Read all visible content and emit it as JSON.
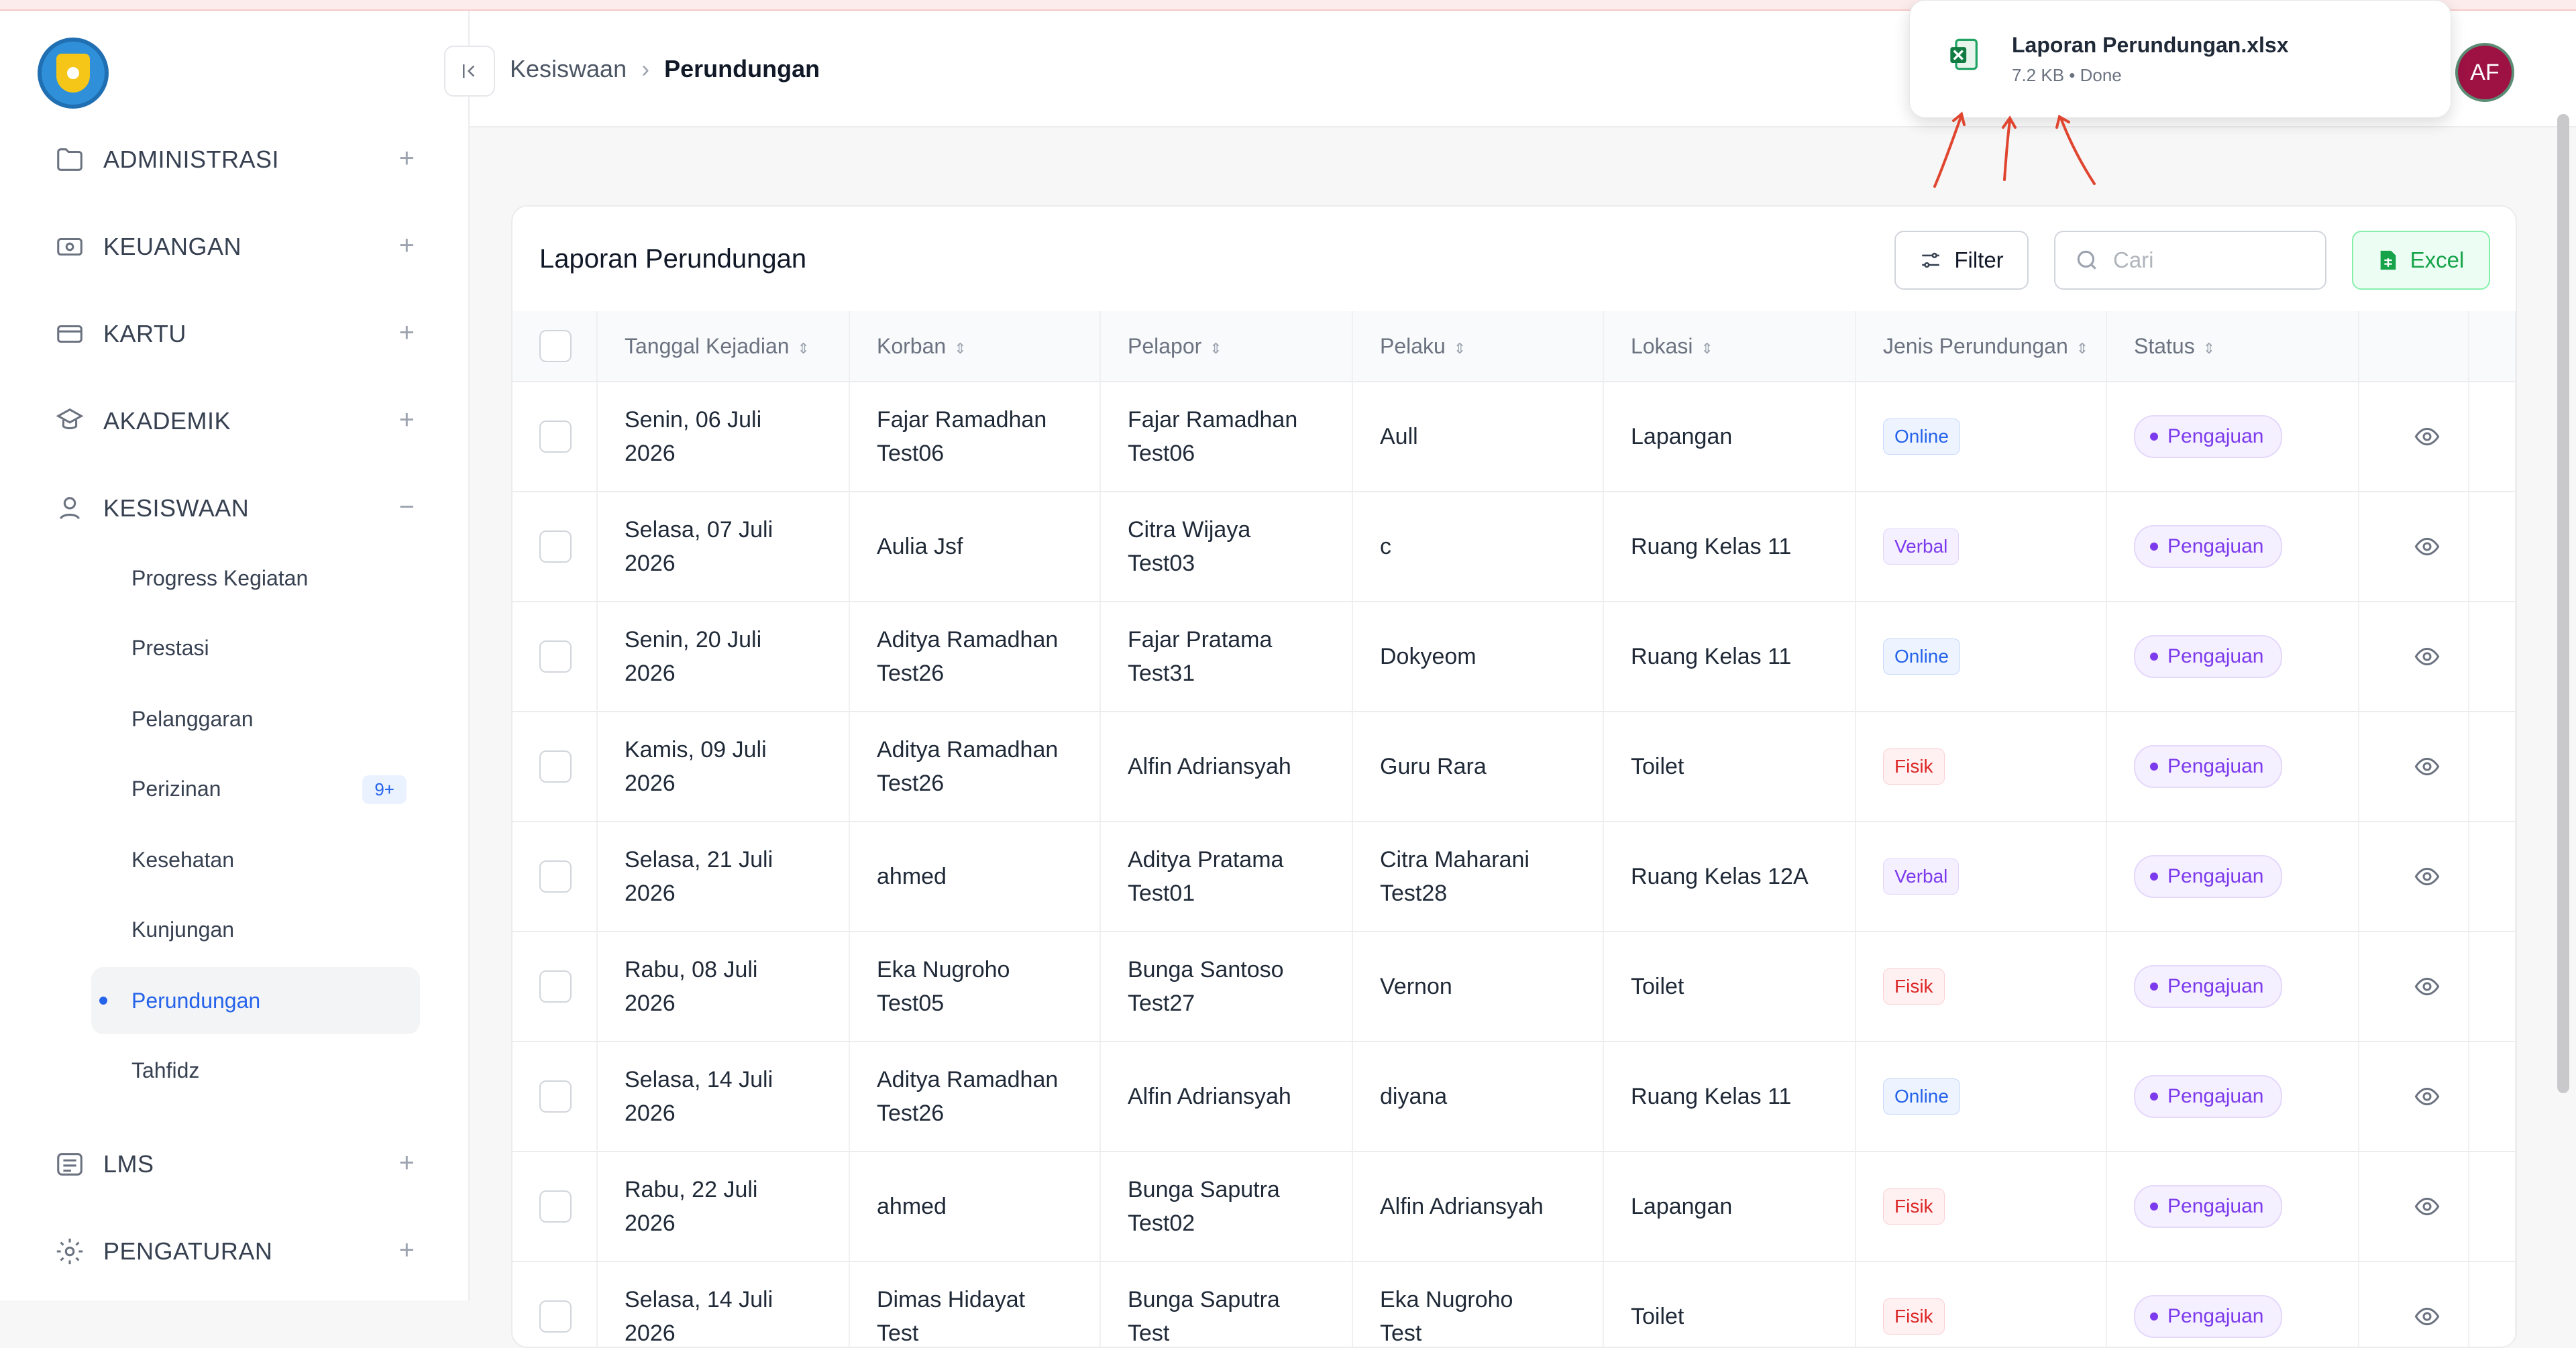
{
  "colors": {
    "accent": "#2563eb",
    "excel": "#16a34a",
    "avatar": "#9d1143",
    "status": "#7c3aed"
  },
  "sidebar": {
    "logo_icon": "tut-wuri-handayani-logo",
    "menu": [
      {
        "label": "ADMINISTRASI",
        "icon": "folder-icon",
        "toggle": "+"
      },
      {
        "label": "KEUANGAN",
        "icon": "money-icon",
        "toggle": "+"
      },
      {
        "label": "KARTU",
        "icon": "card-icon",
        "toggle": "+"
      },
      {
        "label": "AKADEMIK",
        "icon": "academic-icon",
        "toggle": "+"
      },
      {
        "label": "KESISWAAN",
        "icon": "student-icon",
        "toggle": "−"
      },
      {
        "label": "LMS",
        "icon": "list-icon",
        "toggle": "+"
      },
      {
        "label": "PENGATURAN",
        "icon": "gear-icon",
        "toggle": "+"
      }
    ],
    "kesiswaan_items": [
      {
        "label": "Progress Kegiatan"
      },
      {
        "label": "Prestasi"
      },
      {
        "label": "Pelanggaran"
      },
      {
        "label": "Perizinan",
        "badge": "9+"
      },
      {
        "label": "Kesehatan"
      },
      {
        "label": "Kunjungan"
      },
      {
        "label": "Perundungan",
        "active": true
      },
      {
        "label": "Tahfidz"
      }
    ]
  },
  "header": {
    "breadcrumb": [
      "Kesiswaan",
      "Perundungan"
    ],
    "avatar_initials": "AF"
  },
  "download": {
    "filename": "Laporan Perundungan.xlsx",
    "meta": "7.2 KB • Done"
  },
  "card": {
    "title": "Laporan Perundungan",
    "filter_label": "Filter",
    "search_placeholder": "Cari",
    "excel_label": "Excel",
    "columns": [
      "Tanggal Kejadian",
      "Korban",
      "Pelapor",
      "Pelaku",
      "Lokasi",
      "Jenis Perundungan",
      "Status"
    ],
    "rows": [
      {
        "tanggal": [
          "Senin, 06 Juli",
          "2026"
        ],
        "korban": [
          "Fajar Ramadhan",
          "Test06"
        ],
        "pelapor": [
          "Fajar Ramadhan",
          "Test06"
        ],
        "pelaku": [
          "Aull"
        ],
        "lokasi": "Lapangan",
        "jenis": "Online",
        "status": "Pengajuan"
      },
      {
        "tanggal": [
          "Selasa, 07 Juli",
          "2026"
        ],
        "korban": [
          "Aulia Jsf"
        ],
        "pelapor": [
          "Citra Wijaya",
          "Test03"
        ],
        "pelaku": [
          "c"
        ],
        "lokasi": "Ruang Kelas 11",
        "jenis": "Verbal",
        "status": "Pengajuan"
      },
      {
        "tanggal": [
          "Senin, 20 Juli",
          "2026"
        ],
        "korban": [
          "Aditya Ramadhan",
          "Test26"
        ],
        "pelapor": [
          "Fajar Pratama",
          "Test31"
        ],
        "pelaku": [
          "Dokyeom"
        ],
        "lokasi": "Ruang Kelas 11",
        "jenis": "Online",
        "status": "Pengajuan"
      },
      {
        "tanggal": [
          "Kamis, 09 Juli",
          "2026"
        ],
        "korban": [
          "Aditya Ramadhan",
          "Test26"
        ],
        "pelapor": [
          "Alfin Adriansyah"
        ],
        "pelaku": [
          "Guru Rara"
        ],
        "lokasi": "Toilet",
        "jenis": "Fisik",
        "status": "Pengajuan"
      },
      {
        "tanggal": [
          "Selasa, 21 Juli",
          "2026"
        ],
        "korban": [
          "ahmed"
        ],
        "pelapor": [
          "Aditya Pratama",
          "Test01"
        ],
        "pelaku": [
          "Citra Maharani",
          "Test28"
        ],
        "lokasi": "Ruang Kelas 12A",
        "jenis": "Verbal",
        "status": "Pengajuan"
      },
      {
        "tanggal": [
          "Rabu, 08 Juli",
          "2026"
        ],
        "korban": [
          "Eka Nugroho",
          "Test05"
        ],
        "pelapor": [
          "Bunga Santoso",
          "Test27"
        ],
        "pelaku": [
          "Vernon"
        ],
        "lokasi": "Toilet",
        "jenis": "Fisik",
        "status": "Pengajuan"
      },
      {
        "tanggal": [
          "Selasa, 14 Juli",
          "2026"
        ],
        "korban": [
          "Aditya Ramadhan",
          "Test26"
        ],
        "pelapor": [
          "Alfin Adriansyah"
        ],
        "pelaku": [
          "diyana"
        ],
        "lokasi": "Ruang Kelas 11",
        "jenis": "Online",
        "status": "Pengajuan"
      },
      {
        "tanggal": [
          "Rabu, 22 Juli",
          "2026"
        ],
        "korban": [
          "ahmed"
        ],
        "pelapor": [
          "Bunga Saputra",
          "Test02"
        ],
        "pelaku": [
          "Alfin Adriansyah"
        ],
        "lokasi": "Lapangan",
        "jenis": "Fisik",
        "status": "Pengajuan"
      },
      {
        "tanggal": [
          "Selasa, 14 Juli",
          "2026"
        ],
        "korban": [
          "Dimas Hidayat",
          "Test"
        ],
        "pelapor": [
          "Bunga Saputra",
          "Test"
        ],
        "pelaku": [
          "Eka Nugroho",
          "Test"
        ],
        "lokasi": "Toilet",
        "jenis": "Fisik",
        "status": "Pengajuan"
      }
    ]
  }
}
